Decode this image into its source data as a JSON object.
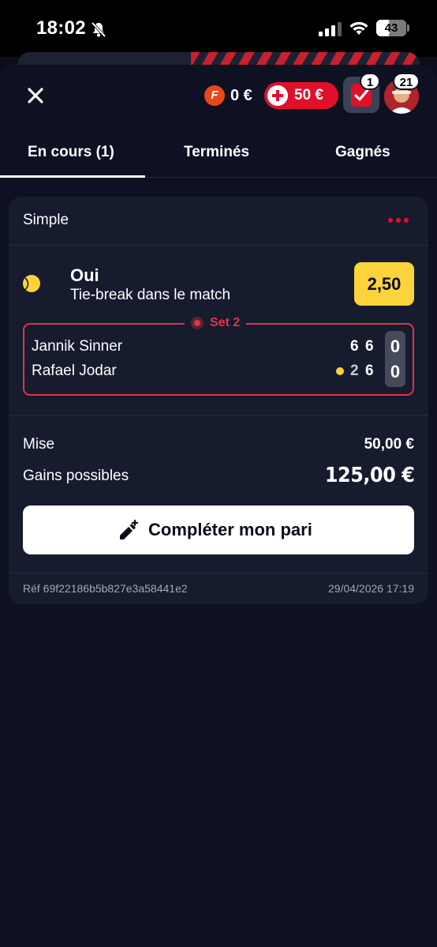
{
  "status_bar": {
    "time": "18:02",
    "battery": "43"
  },
  "header": {
    "freebet_coin_letter": "F",
    "freebet_balance": "0 €",
    "deposit_label": "50 €",
    "betslip_count": "1",
    "notifications_count": "21",
    "icons": [
      "close-icon",
      "plus-icon",
      "betslip-check-icon",
      "avatar"
    ]
  },
  "tabs": [
    {
      "label": "En cours (1)",
      "active": true
    },
    {
      "label": "Terminés",
      "active": false
    },
    {
      "label": "Gagnés",
      "active": false
    }
  ],
  "bet": {
    "type": "Simple",
    "selection": "Oui",
    "market": "Tie-break dans le match",
    "odds": "2,50",
    "live": {
      "set_label": "Set 2",
      "players": [
        {
          "name": "Jannik Sinner",
          "set1": "6",
          "set2": "6",
          "game": "0",
          "serving": false
        },
        {
          "name": "Rafael Jodar",
          "set1": "2",
          "set2": "6",
          "game": "0",
          "serving": true
        }
      ]
    },
    "stake_label": "Mise",
    "stake_value": "50,00 €",
    "gains_label": "Gains possibles",
    "gains_value": "125,00 €",
    "complete_button": "Compléter mon pari",
    "reference": "Réf 69f22186b5b827e3a58441e2",
    "datetime": "29/04/2026 17:19"
  },
  "colors": {
    "background": "#0b0d1a",
    "card": "#171b2e",
    "accent_red": "#e0102a",
    "odds_yellow": "#fcd33a",
    "live_red": "#e0344a"
  }
}
